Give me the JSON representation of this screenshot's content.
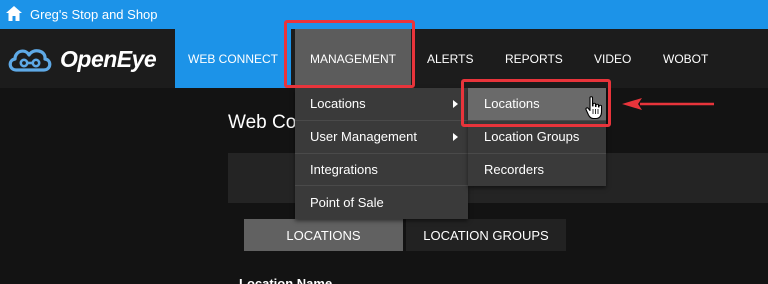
{
  "topbar": {
    "site_name": "Greg's Stop and Shop",
    "icon": "home-icon",
    "color": "#1c93e8"
  },
  "logo": {
    "text": "OpenEye",
    "icon": "cloud-logo-icon"
  },
  "nav": {
    "web_connect": "WEB CONNECT",
    "management": "MANAGEMENT",
    "alerts": "ALERTS",
    "reports": "REPORTS",
    "video": "VIDEO",
    "wobot": "WOBOT",
    "active": "MANAGEMENT"
  },
  "management_menu": {
    "items": [
      {
        "label": "Locations",
        "has_submenu": true
      },
      {
        "label": "User Management",
        "has_submenu": true
      },
      {
        "label": "Integrations",
        "has_submenu": false
      },
      {
        "label": "Point of Sale",
        "has_submenu": false
      }
    ]
  },
  "locations_submenu": {
    "items": [
      {
        "label": "Locations",
        "hovered": true
      },
      {
        "label": "Location Groups",
        "hovered": false
      },
      {
        "label": "Recorders",
        "hovered": false
      }
    ]
  },
  "main": {
    "title": "Web Co",
    "tabs": {
      "locations": "LOCATIONS",
      "location_groups": "LOCATION GROUPS"
    },
    "column_header": "Location Name"
  },
  "annotations": {
    "highlight_color": "#e8343b",
    "pointer": "hand-cursor-icon",
    "arrow": "red-arrow-icon"
  }
}
